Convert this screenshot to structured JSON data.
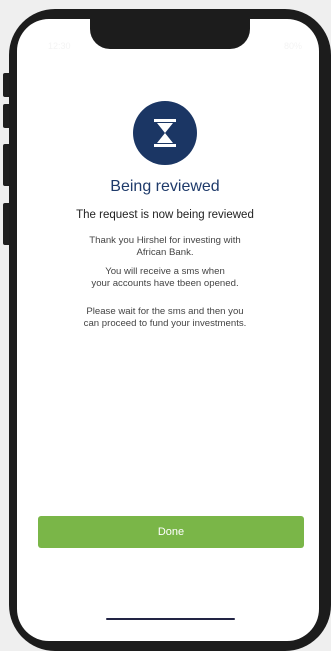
{
  "status_bar": {
    "time": "12:30",
    "right": "80%"
  },
  "icon": {
    "name": "hourglass-icon",
    "background": "#1b3664",
    "color": "#ffffff"
  },
  "title": "Being reviewed",
  "subtitle": "The request is now being reviewed",
  "paragraphs": {
    "p1_line1": "Thank you Hirshel for investing with",
    "p1_line2": "African Bank.",
    "p2_line1": "You will receive a sms when",
    "p2_line2": "your accounts have tbeen opened.",
    "p3_line1": "Please wait for the sms and then you",
    "p3_line2": "can proceed to fund your investments."
  },
  "done_button": {
    "label": "Done",
    "color": "#7ab648"
  }
}
